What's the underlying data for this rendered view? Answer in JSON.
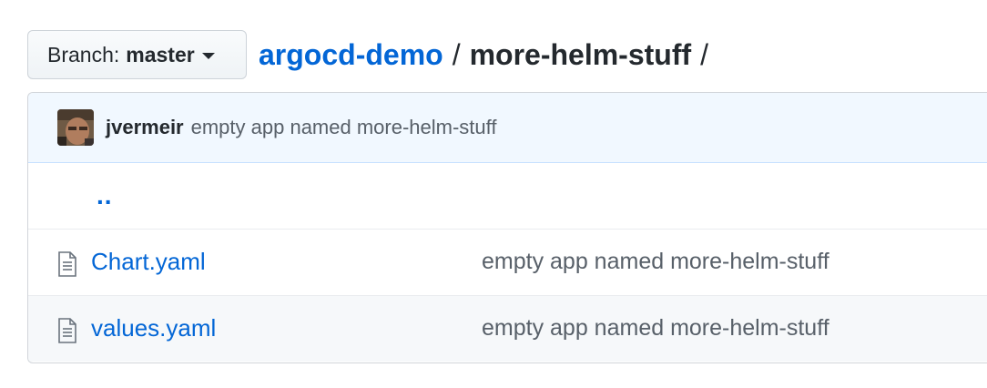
{
  "branch": {
    "prefix": "Branch:",
    "name": "master"
  },
  "breadcrumb": {
    "repo": "argocd-demo",
    "separator": "/",
    "current_dir": "more-helm-stuff",
    "trailing_separator": "/"
  },
  "latest_commit": {
    "author": "jvermeir",
    "message": "empty app named more-helm-stuff"
  },
  "parent_dir_label": "..",
  "files": [
    {
      "name": "Chart.yaml",
      "icon": "file-icon",
      "commit_message": "empty app named more-helm-stuff"
    },
    {
      "name": "values.yaml",
      "icon": "file-icon",
      "commit_message": "empty app named more-helm-stuff"
    }
  ],
  "colors": {
    "link": "#0366d6",
    "commit_header_bg": "#f1f8ff",
    "muted_text": "#586069"
  }
}
